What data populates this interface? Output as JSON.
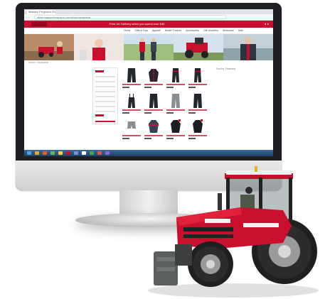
{
  "screen": {
    "browser_tab": "Massey Ferguson Shop",
    "address": "www.masseyferguson.com/shop/workwear",
    "promo": "Free UK Delivery when you spend over £40",
    "menu": [
      "Home",
      "Gifts & Toys",
      "Apparel",
      "Model Tractors",
      "Accessories",
      "Gift Vouchers",
      "Workwear",
      "Sale"
    ],
    "breadcrumb": "Home / Workwear",
    "sort": "Sort by: Featured"
  },
  "colors": {
    "brand_red": "#c8102e",
    "monitor_frame": "#1d1f22",
    "tractor_red": "#c8102e",
    "tractor_dark": "#2a2a2a"
  },
  "icons": [
    "monitor",
    "tractor"
  ]
}
